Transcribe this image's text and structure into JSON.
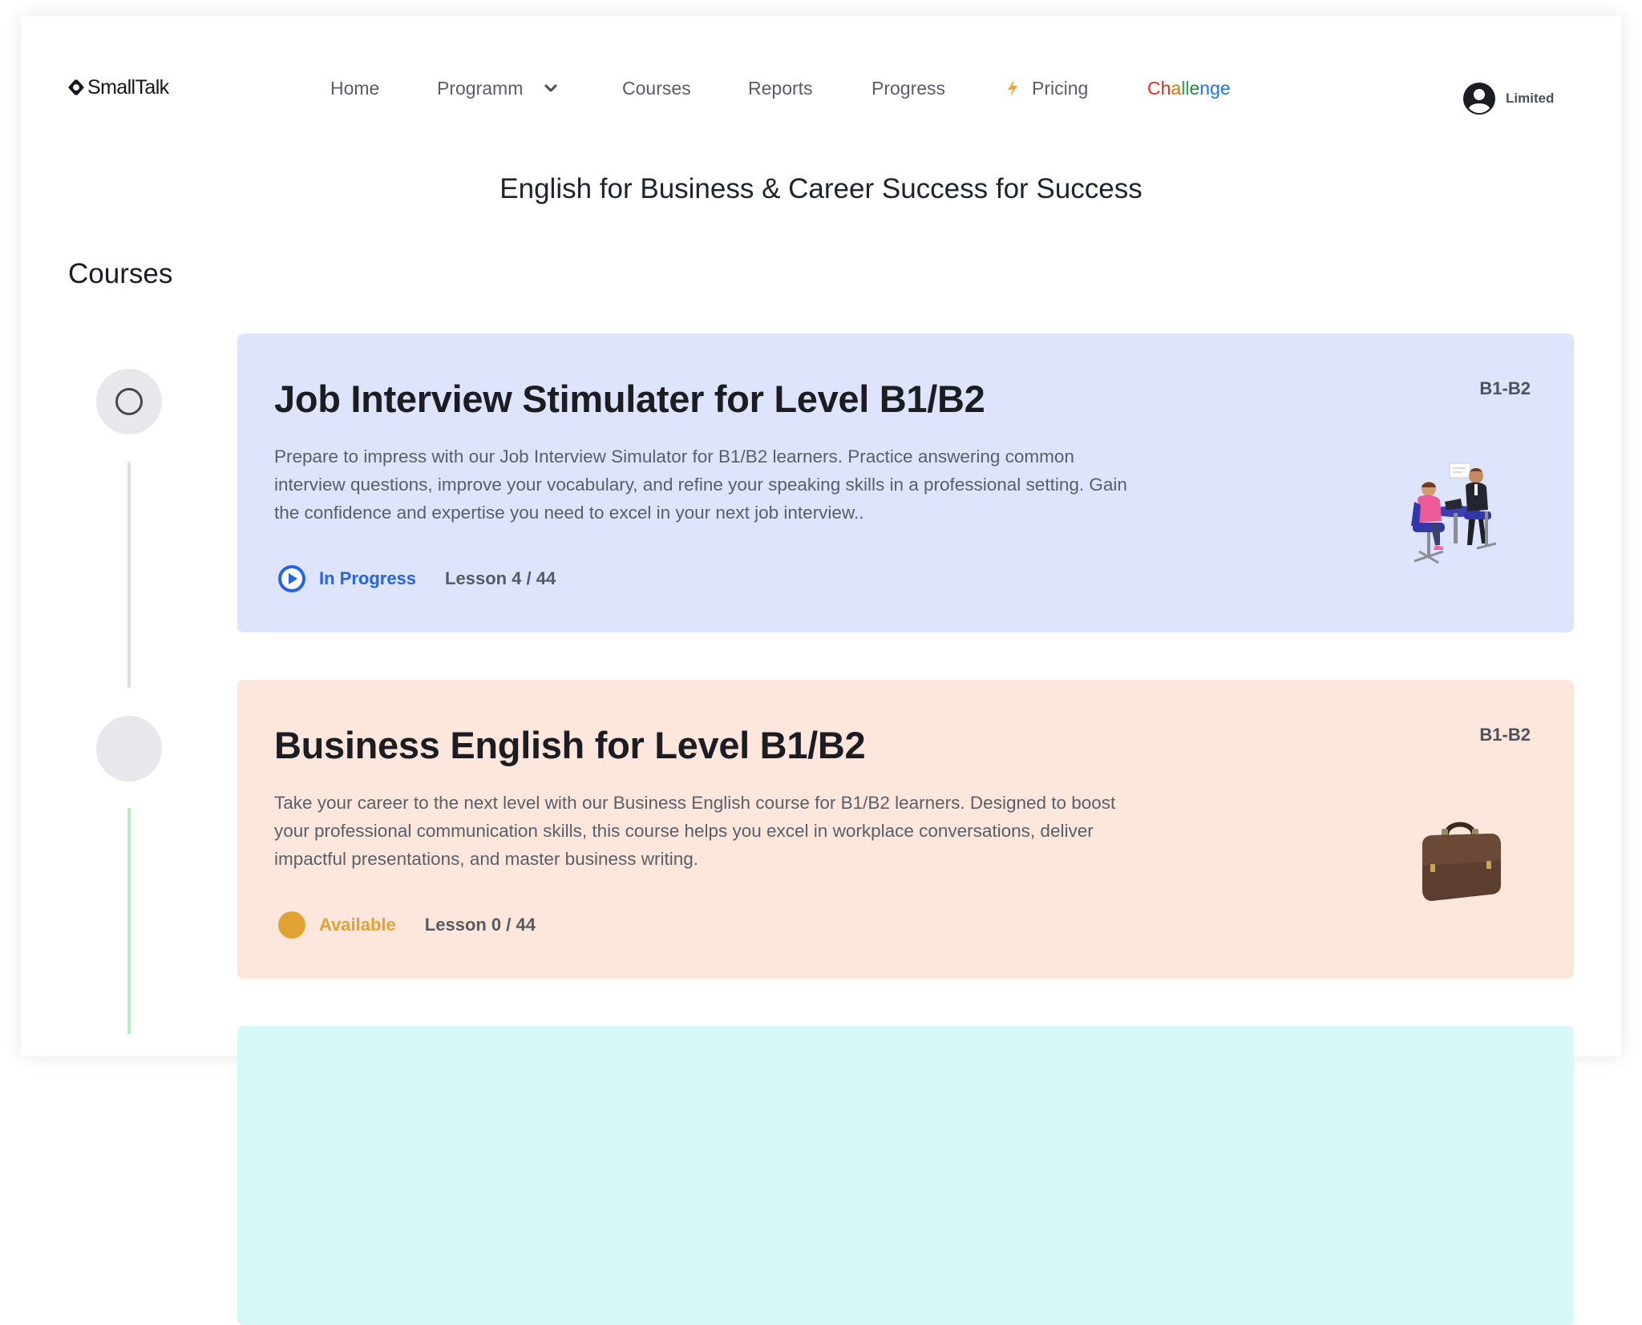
{
  "brand": {
    "name": "SmallTalk"
  },
  "nav": {
    "home": "Home",
    "programm": "Programm",
    "courses": "Courses",
    "reports": "Reports",
    "progress": "Progress",
    "pricing": "Pricing",
    "challenge_letters": [
      "C",
      "h",
      "a",
      "l",
      "l",
      "e",
      "n",
      "g",
      "e"
    ],
    "challenge_colors": [
      "#d93025",
      "#d93025",
      "#e37400",
      "#2e9d4f",
      "#2e9d4f",
      "#1e8e3e",
      "#1a73e8",
      "#1a73e8",
      "#1a73e8"
    ]
  },
  "account": {
    "label": "Limited"
  },
  "program_title": "English for Business & Career Success for Success",
  "section_title": "Courses",
  "courses": [
    {
      "title": "Job Interview Stimulater for Level B1/B2",
      "level": "B1-B2",
      "description": "Prepare to impress with our Job Interview Simulator for B1/B2 learners. Practice answering common interview questions, improve your vocabulary, and refine your speaking skills in a professional setting. Gain the confidence and expertise you need to excel in your next job interview..",
      "status": "In Progress",
      "status_color": "#2563eb",
      "lesson": "Lesson 4 / 44",
      "card_color": "#dde4fc",
      "icon": "play-circle-icon",
      "illustration": "interview-illustration"
    },
    {
      "title": "Business English for Level B1/B2",
      "level": "B1-B2",
      "description": "Take your career to the next level with our Business English course for B1/B2 learners. Designed to boost your professional communication skills, this course helps you excel in workplace conversations, deliver impactful presentations, and master business writing.",
      "status": "Available",
      "status_color": "#e2a233",
      "lesson": "Lesson 0 / 44",
      "card_color": "#fde7dc",
      "icon": "dot-circle-icon",
      "illustration": "briefcase-illustration"
    },
    {
      "card_color": "#d6f8f6"
    }
  ],
  "colors": {
    "nav_text": "#585d68",
    "track_gray": "#dddfe3",
    "track_green": "#b9ecc4",
    "bolt": "#f0a43a"
  }
}
